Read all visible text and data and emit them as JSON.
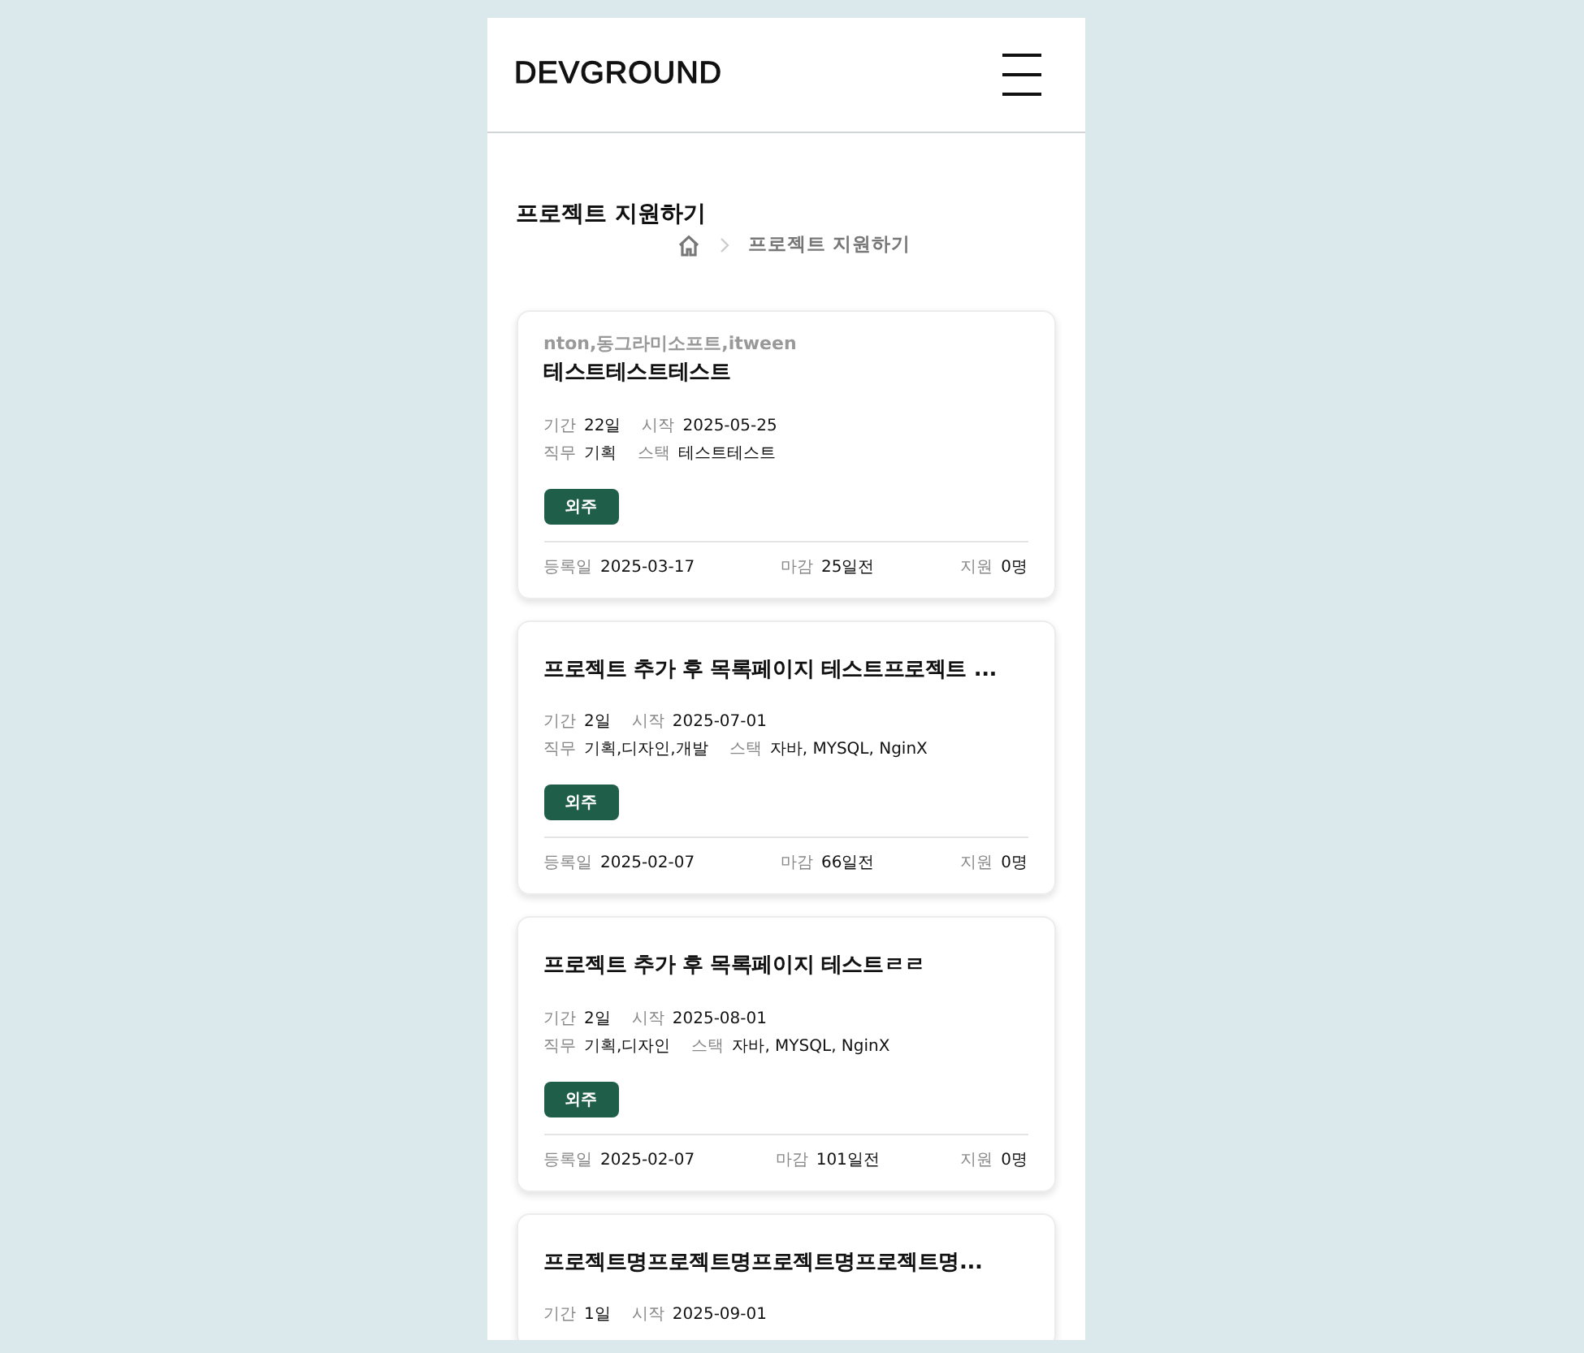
{
  "header": {
    "logo": "DEVGROUND"
  },
  "page": {
    "title": "프로젝트 지원하기",
    "breadcrumb": [
      {
        "label": "프로젝트 지원하기"
      }
    ]
  },
  "cards": [
    {
      "company": "nton,동그라미소프트,itween",
      "title": "테스트테스트테스트",
      "info": [
        [
          {
            "label": "기간",
            "value": "22일"
          },
          {
            "label": "시작",
            "value": "2025-05-25"
          }
        ],
        [
          {
            "label": "직무",
            "value": "기획"
          },
          {
            "label": "스택",
            "value": "테스트테스트"
          }
        ]
      ],
      "tag": "외주",
      "footer": [
        {
          "label": "등록일",
          "value": "2025-03-17"
        },
        {
          "label": "마감",
          "value": "25일전"
        },
        {
          "label": "지원",
          "value": "0명"
        }
      ]
    },
    {
      "title": "프로젝트 추가 후 목록페이지 테스트프로젝트 ...",
      "info": [
        [
          {
            "label": "기간",
            "value": "2일"
          },
          {
            "label": "시작",
            "value": "2025-07-01"
          }
        ],
        [
          {
            "label": "직무",
            "value": "기획,디자인,개발"
          },
          {
            "label": "스택",
            "value": "자바, MYSQL, NginX"
          }
        ]
      ],
      "tag": "외주",
      "footer": [
        {
          "label": "등록일",
          "value": "2025-02-07"
        },
        {
          "label": "마감",
          "value": "66일전"
        },
        {
          "label": "지원",
          "value": "0명"
        }
      ]
    },
    {
      "title": "프로젝트 추가 후 목록페이지 테스트ㄹㄹ",
      "info": [
        [
          {
            "label": "기간",
            "value": "2일"
          },
          {
            "label": "시작",
            "value": "2025-08-01"
          }
        ],
        [
          {
            "label": "직무",
            "value": "기획,디자인"
          },
          {
            "label": "스택",
            "value": "자바, MYSQL, NginX"
          }
        ]
      ],
      "tag": "외주",
      "footer": [
        {
          "label": "등록일",
          "value": "2025-02-07"
        },
        {
          "label": "마감",
          "value": "101일전"
        },
        {
          "label": "지원",
          "value": "0명"
        }
      ]
    },
    {
      "title": "프로젝트명프로젝트명프로젝트명프로젝트명...",
      "info": [
        [
          {
            "label": "기간",
            "value": "1일"
          },
          {
            "label": "시작",
            "value": "2025-09-01"
          }
        ]
      ]
    }
  ]
}
